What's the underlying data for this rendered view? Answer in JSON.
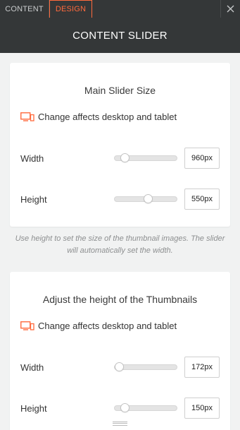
{
  "tabs": [
    {
      "label": "CONTENT",
      "active": false
    },
    {
      "label": "DESIGN",
      "active": true
    }
  ],
  "header": {
    "title": "CONTENT SLIDER"
  },
  "colors": {
    "accent": "#ff6a3d",
    "dark_bar": "#343738",
    "background": "#f1f2f2"
  },
  "main_slider": {
    "title": "Main Slider Size",
    "notice": "Change affects desktop and tablet",
    "notice_icon": "devices-icon",
    "rows": [
      {
        "label": "Width",
        "value": "960px",
        "level": 0.1
      },
      {
        "label": "Height",
        "value": "550px",
        "level": 0.55
      }
    ]
  },
  "hint": "Use height to set the size of the thumbnail images. The slider will automatically set the width.",
  "thumbnails": {
    "title": "Adjust the height of the Thumbnails",
    "notice": "Change affects desktop and tablet",
    "notice_icon": "devices-icon",
    "rows": [
      {
        "label": "Width",
        "value": "172px",
        "level": 0.0
      },
      {
        "label": "Height",
        "value": "150px",
        "level": 0.1
      }
    ]
  }
}
